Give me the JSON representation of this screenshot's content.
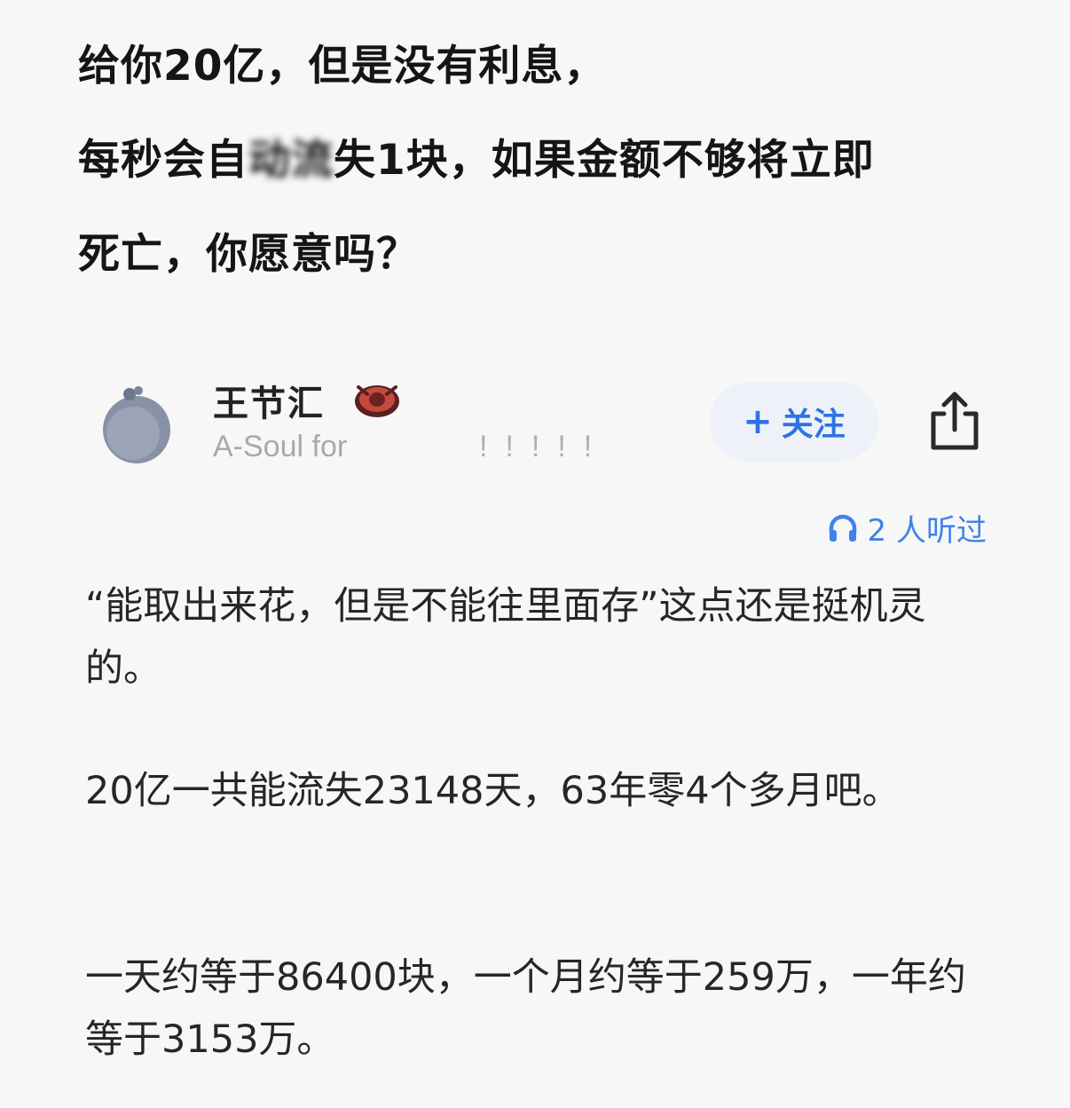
{
  "question": {
    "line1": "给你20亿，但是没有利息，",
    "line2_pre": "每秒会自",
    "line2_blur": "动流",
    "line2_post": "失1块，如果金额不够将立即",
    "line3": "死亡，你愿意吗？"
  },
  "author": {
    "name": "王节汇",
    "subtitle": "A-Soul for",
    "subtitle_tail": "!!!!!"
  },
  "follow": {
    "plus": "+",
    "label": "关注"
  },
  "listened": {
    "text": "2 人听过"
  },
  "answer": {
    "paragraphs": [
      "“能取出来花，但是不能往里面存”这点还是挺机灵的。",
      "20亿一共能流失23148天，63年零4个多月吧。",
      "一天约等于86400块，一个月约等于259万，一年约等于3153万。"
    ]
  },
  "colors": {
    "accent": "#2d73e6",
    "follow_bg": "#eef2f8",
    "background": "#f7f7f7"
  },
  "icons": {
    "share": "share-icon",
    "headphones": "headphones-icon",
    "badge": "badge-icon"
  }
}
